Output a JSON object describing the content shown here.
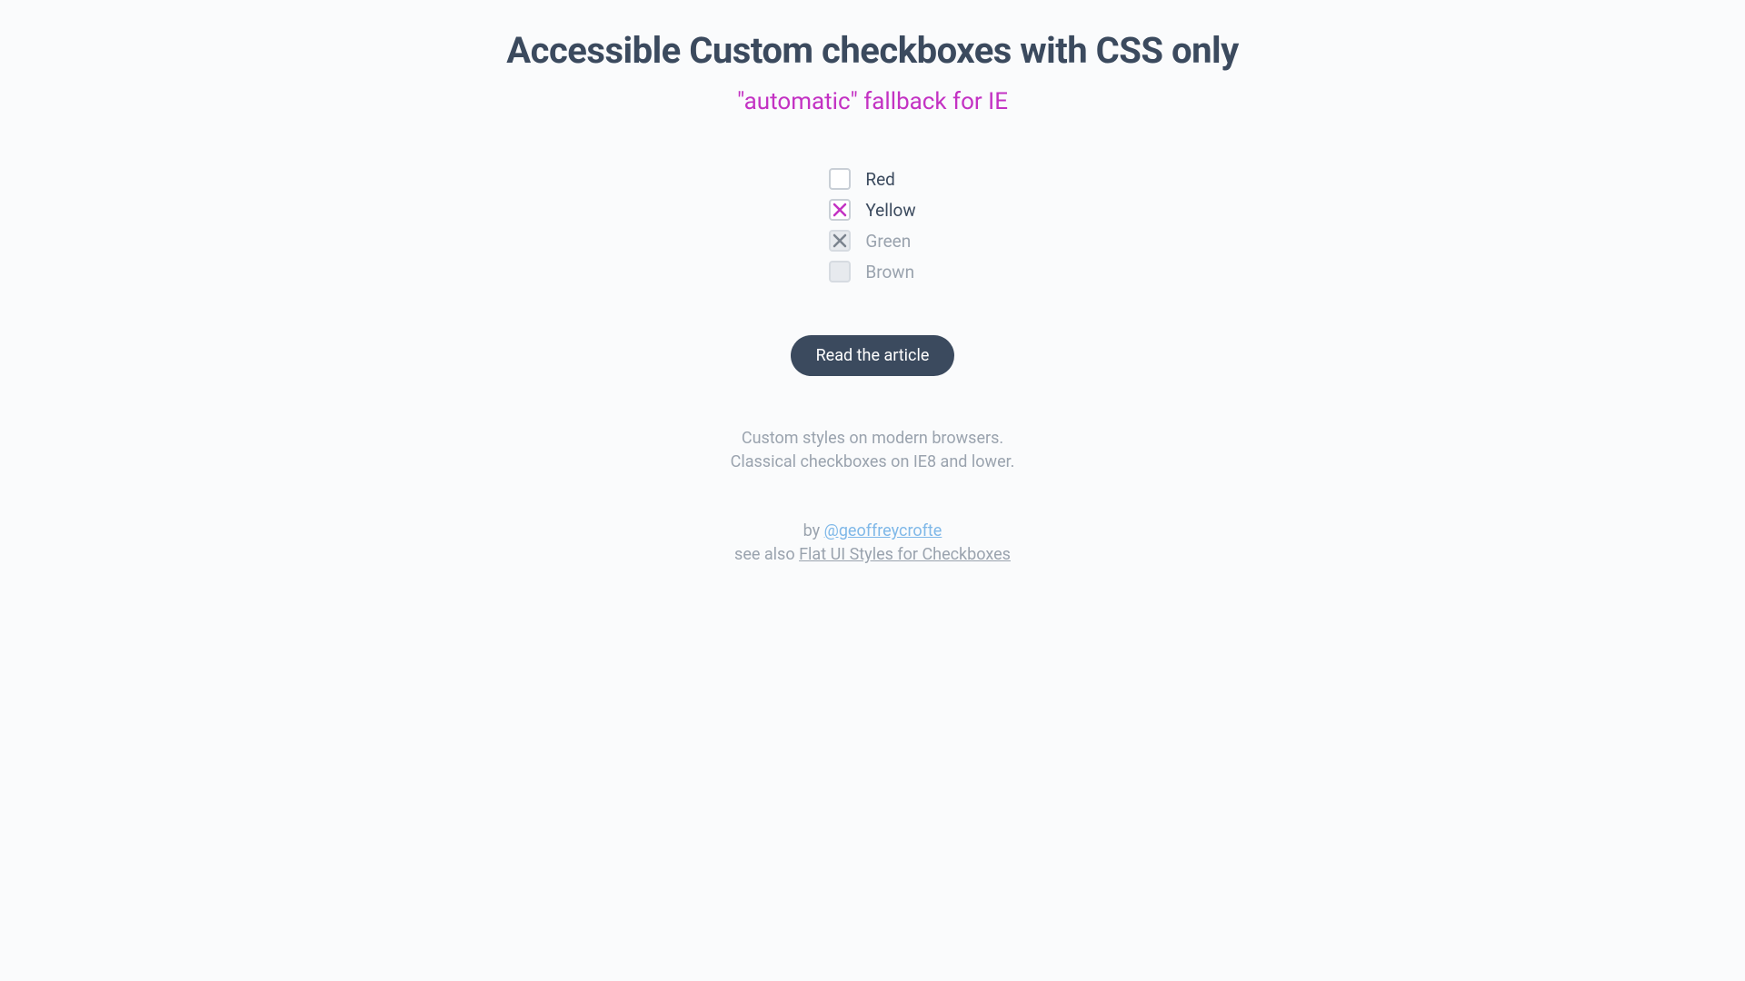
{
  "title": "Accessible Custom checkboxes with CSS only",
  "subtitle": "\"automatic\" fallback for IE",
  "checkboxes": [
    {
      "label": "Red",
      "checked": false,
      "disabled": false
    },
    {
      "label": "Yellow",
      "checked": true,
      "disabled": false
    },
    {
      "label": "Green",
      "checked": true,
      "disabled": true
    },
    {
      "label": "Brown",
      "checked": false,
      "disabled": true
    }
  ],
  "button_label": "Read the article",
  "note_line1": "Custom styles on modern browsers.",
  "note_line2": "Classical checkboxes on IE8 and lower.",
  "credits": {
    "by": "by ",
    "author": "@geoffreycrofte",
    "see_also": "see also ",
    "related": "Flat UI Styles for Checkboxes"
  },
  "colors": {
    "accent_checked": "#c332c3",
    "disabled_x": "#7a838e"
  }
}
